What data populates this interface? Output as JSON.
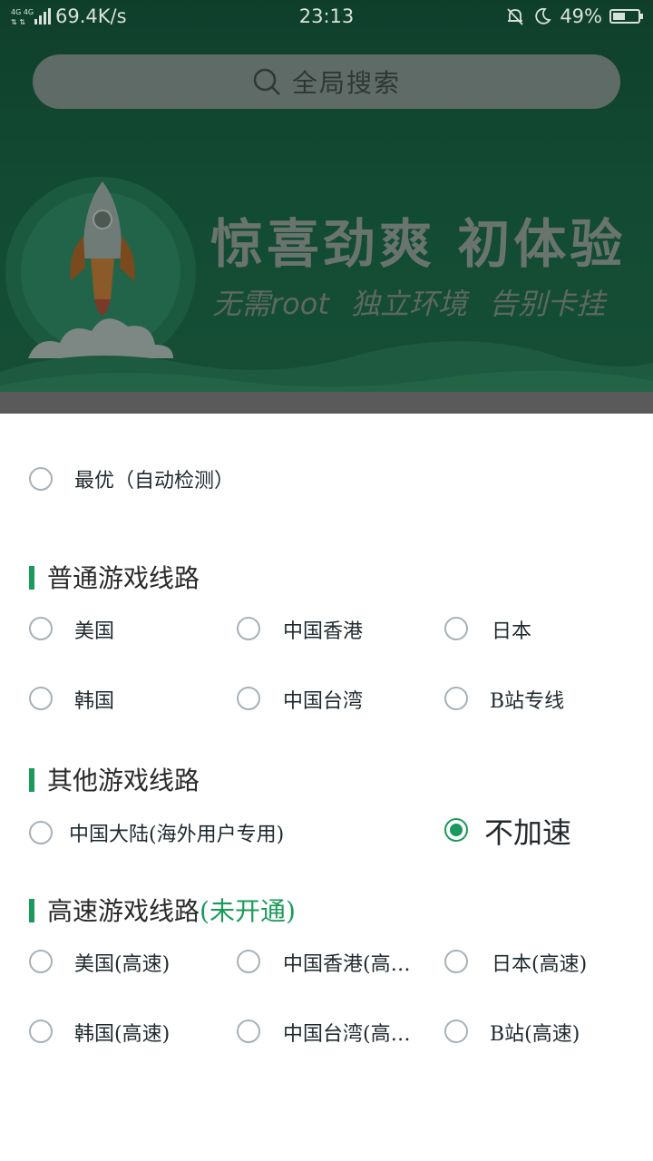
{
  "status_bar": {
    "network_speed": "69.4K/s",
    "time": "23:13",
    "battery_percent": "49%",
    "battery_level": 0.49
  },
  "search": {
    "label": "全局搜索"
  },
  "hero": {
    "slogan": "惊喜劲爽  初体验",
    "subslogan": "无需root 独立环境 告别卡挂"
  },
  "options": {
    "best": "最优（自动检测）"
  },
  "sections": [
    {
      "title": "普通游戏线路",
      "tag": "",
      "items": [
        "美国",
        "中国香港",
        "日本",
        "韩国",
        "中国台湾",
        "B站专线"
      ]
    },
    {
      "title": "其他游戏线路",
      "tag": "",
      "items": [
        "中国大陆(海外用户专用)",
        "不加速"
      ]
    },
    {
      "title": "高速游戏线路",
      "tag": "(未开通)",
      "items": [
        "美国(高速)",
        "中国香港(高…",
        "日本(高速)",
        "韩国(高速)",
        "中国台湾(高…",
        "B站(高速)"
      ]
    }
  ],
  "selected": "不加速",
  "colors": {
    "accent": "#1a9a5b",
    "hero": "#124a33"
  }
}
